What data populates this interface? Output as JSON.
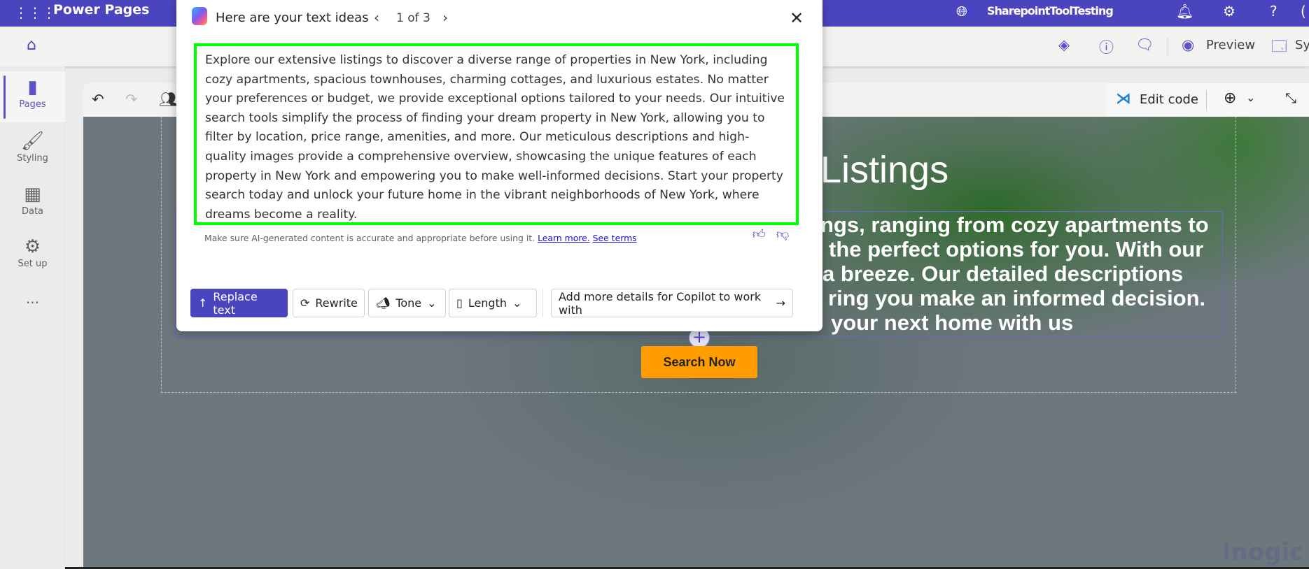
{
  "topbar": {
    "app_title": "Power Pages",
    "environment": "SharepointToolTesting"
  },
  "cmdbar": {
    "preview_label": "Preview",
    "sync_label": "Sy"
  },
  "rail": {
    "items": [
      {
        "label": "Pages",
        "active": true
      },
      {
        "label": "Styling"
      },
      {
        "label": "Data"
      },
      {
        "label": "Set up"
      }
    ],
    "more": "..."
  },
  "canvas_toolbar": {
    "edit_code_label": "Edit code"
  },
  "page": {
    "heading": "Listings",
    "paragraph_lines": [
      "ngs, ranging from cozy apartments to",
      "the perfect options for you. With our",
      "a breeze. Our detailed descriptions",
      "ring you make an informed decision.",
      "your next home with us"
    ],
    "search_button": "Search Now",
    "watermark": "Inogic"
  },
  "dialog": {
    "title": "Here are your text ideas",
    "pager": "1 of 3",
    "idea_text": "Explore our extensive listings to discover a diverse range of properties in New York, including cozy apartments, spacious townhouses, charming cottages, and luxurious estates. No matter your preferences or budget, we provide exceptional options tailored to your needs. Our intuitive search tools simplify the process of finding your dream property in New York, allowing you to filter by location, price range, amenities, and more. Our meticulous descriptions and high-quality images provide a comprehensive overview, showcasing the unique features of each property in New York and empowering you to make well-informed decisions. Start your property search today and unlock your future home in the vibrant neighborhoods of New York, where dreams become a reality.",
    "disclaimer": "Make sure AI-generated content is accurate and appropriate before using it.",
    "learn_more": "Learn more.",
    "see_terms": "See terms",
    "buttons": {
      "replace": "Replace text",
      "rewrite": "Rewrite",
      "tone": "Tone",
      "length": "Length",
      "add_details": "Add more details for Copilot to work with"
    }
  },
  "colors": {
    "brand": "#4b44bf",
    "highlight": "#00ff00",
    "search_button": "#ff9d00"
  }
}
